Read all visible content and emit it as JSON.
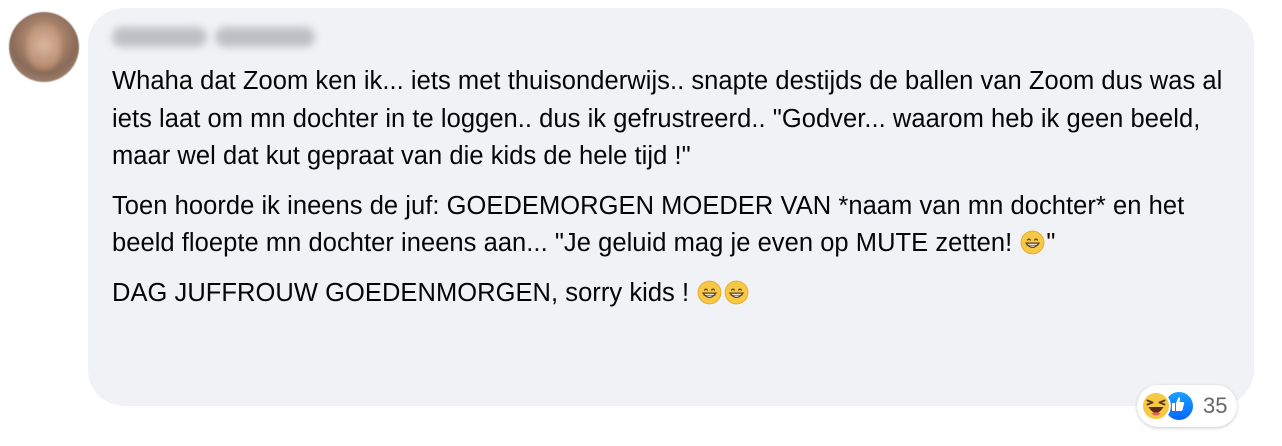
{
  "comment": {
    "author_name": "",
    "paragraphs": [
      {
        "text": "Whaha dat Zoom ken ik... iets met thuisonderwijs.. snapte destijds de ballen van Zoom dus was al iets laat om mn dochter in te loggen.. dus ik gefrustreerd.. \"Godver... waarom heb ik geen beeld, maar wel dat kut gepraat van die kids de hele tijd !\""
      },
      {
        "text_before_emoji": "Toen hoorde ik ineens de juf: GOEDEMORGEN MOEDER VAN *naam van mn dochter* en het beeld floepte mn dochter ineens aan... \"Je geluid mag je even op MUTE zetten! ",
        "emoji": "grinning-face-emoji",
        "text_after_emoji": "\""
      },
      {
        "text_before_emoji": "DAG JUFFROUW GOEDENMORGEN, sorry kids ! ",
        "emojis": [
          "grinning-face-emoji",
          "grinning-face-emoji"
        ]
      }
    ]
  },
  "reactions": {
    "icons": [
      "haha-reaction-icon",
      "like-reaction-icon"
    ],
    "count": "35"
  },
  "colors": {
    "bubble_background": "#f0f2f5",
    "text": "#050505",
    "secondary_text": "#65676b",
    "like_blue": "#0866ff",
    "emoji_yellow": "#f7c844"
  }
}
